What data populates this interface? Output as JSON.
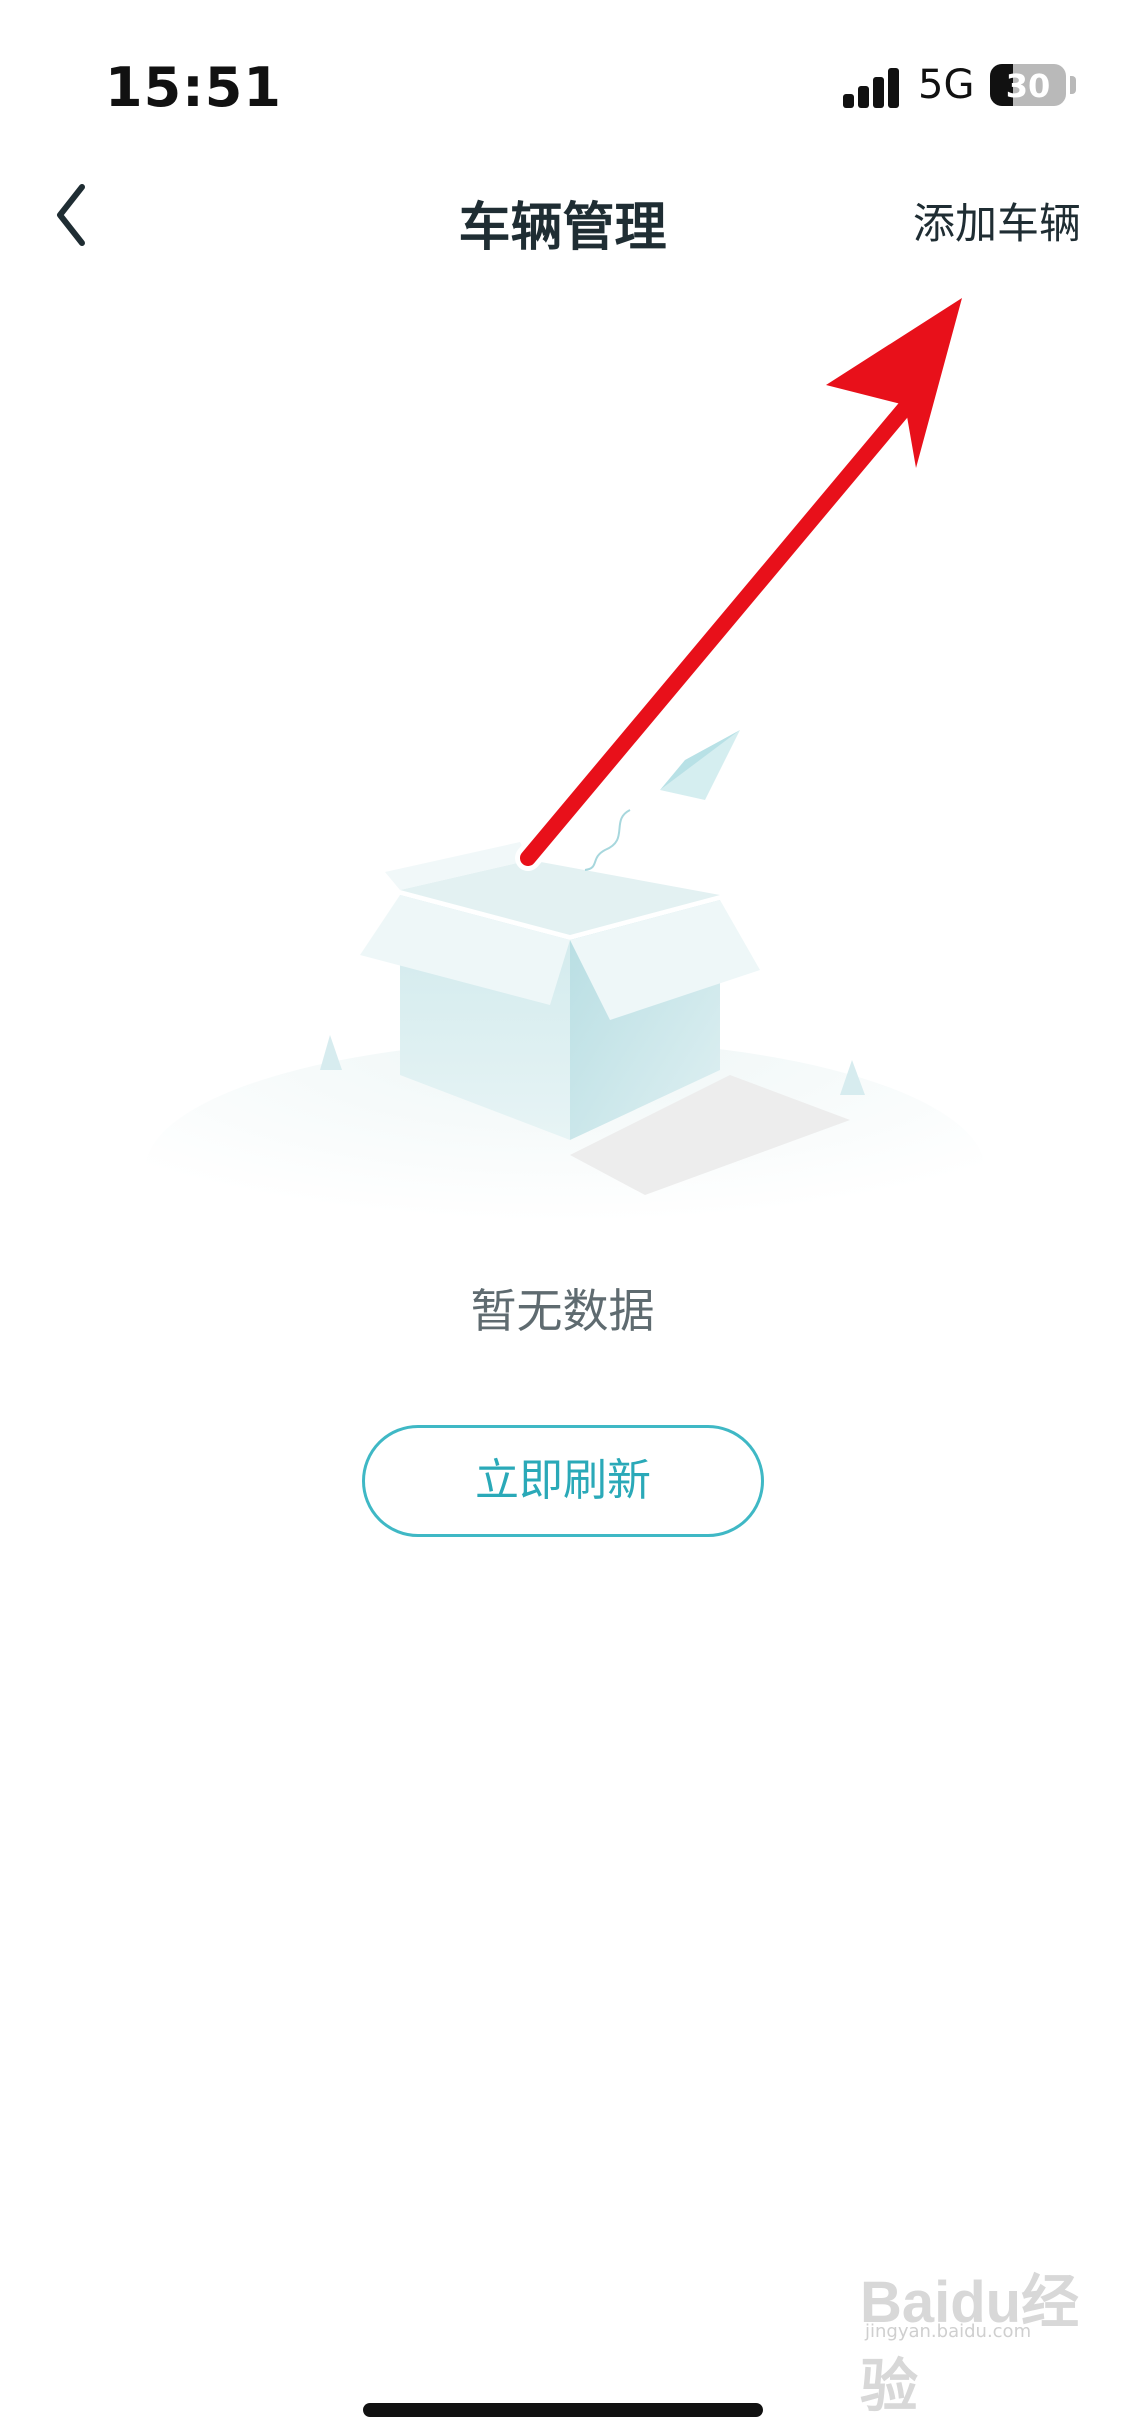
{
  "status_bar": {
    "time": "15:51",
    "network": "5G",
    "battery": "30"
  },
  "nav_bar": {
    "back_icon": "chevron-left-icon",
    "title": "车辆管理",
    "add_vehicle_label": "添加车辆"
  },
  "empty_state": {
    "illustration": "open-box-with-paper-plane",
    "message": "暂无数据",
    "refresh_label": "立即刷新"
  },
  "annotation": {
    "type": "red-arrow",
    "points_to": "添加车辆",
    "color": "#e8101a"
  },
  "watermark": {
    "logo": "Baidu经验",
    "sub": "jingyan.baidu.com"
  },
  "colors": {
    "accent": "#3fb8c5",
    "title": "#1f2d33",
    "muted_text": "#5f6b70",
    "arrow": "#e8101a"
  }
}
